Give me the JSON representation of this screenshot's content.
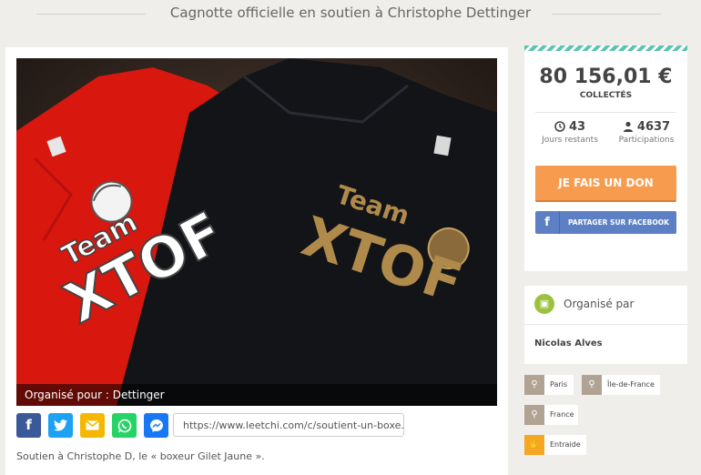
{
  "header": {
    "title": "Cagnotte officielle en soutien à Christophe Dettinger"
  },
  "photo": {
    "shirt_text_top": "Team",
    "shirt_text_bottom": "XTOF",
    "organized_for": "Organisé pour : Dettinger"
  },
  "share": {
    "buttons": [
      {
        "name": "facebook",
        "color": "#3b5998"
      },
      {
        "name": "twitter",
        "color": "#1da1f2"
      },
      {
        "name": "email",
        "color": "#f5b800"
      },
      {
        "name": "whatsapp",
        "color": "#25d366"
      },
      {
        "name": "messenger",
        "color": "#1877f2"
      }
    ],
    "url": "https://www.leetchi.com/c/soutient-un-boxe..."
  },
  "description": "Soutien à Christophe D, le « boxeur Gilet Jaune ».",
  "stats": {
    "amount": "80 156,01 €",
    "collected_label": "COLLECTÉS",
    "days_left": "43",
    "days_left_label": "Jours restants",
    "participants": "4637",
    "participants_label": "Participations",
    "donate_label": "JE FAIS UN DON",
    "facebook_share_label": "PARTAGER SUR FACEBOOK",
    "stripe_color": "#5bc3b0",
    "donate_color": "#f79b4e",
    "facebook_color": "#5d7fc4"
  },
  "organizer": {
    "label": "Organisé par",
    "name": "Nicolas Alves"
  },
  "tags": {
    "city": "Paris",
    "region": "Île-de-France",
    "country": "France",
    "category": "Entraide"
  }
}
